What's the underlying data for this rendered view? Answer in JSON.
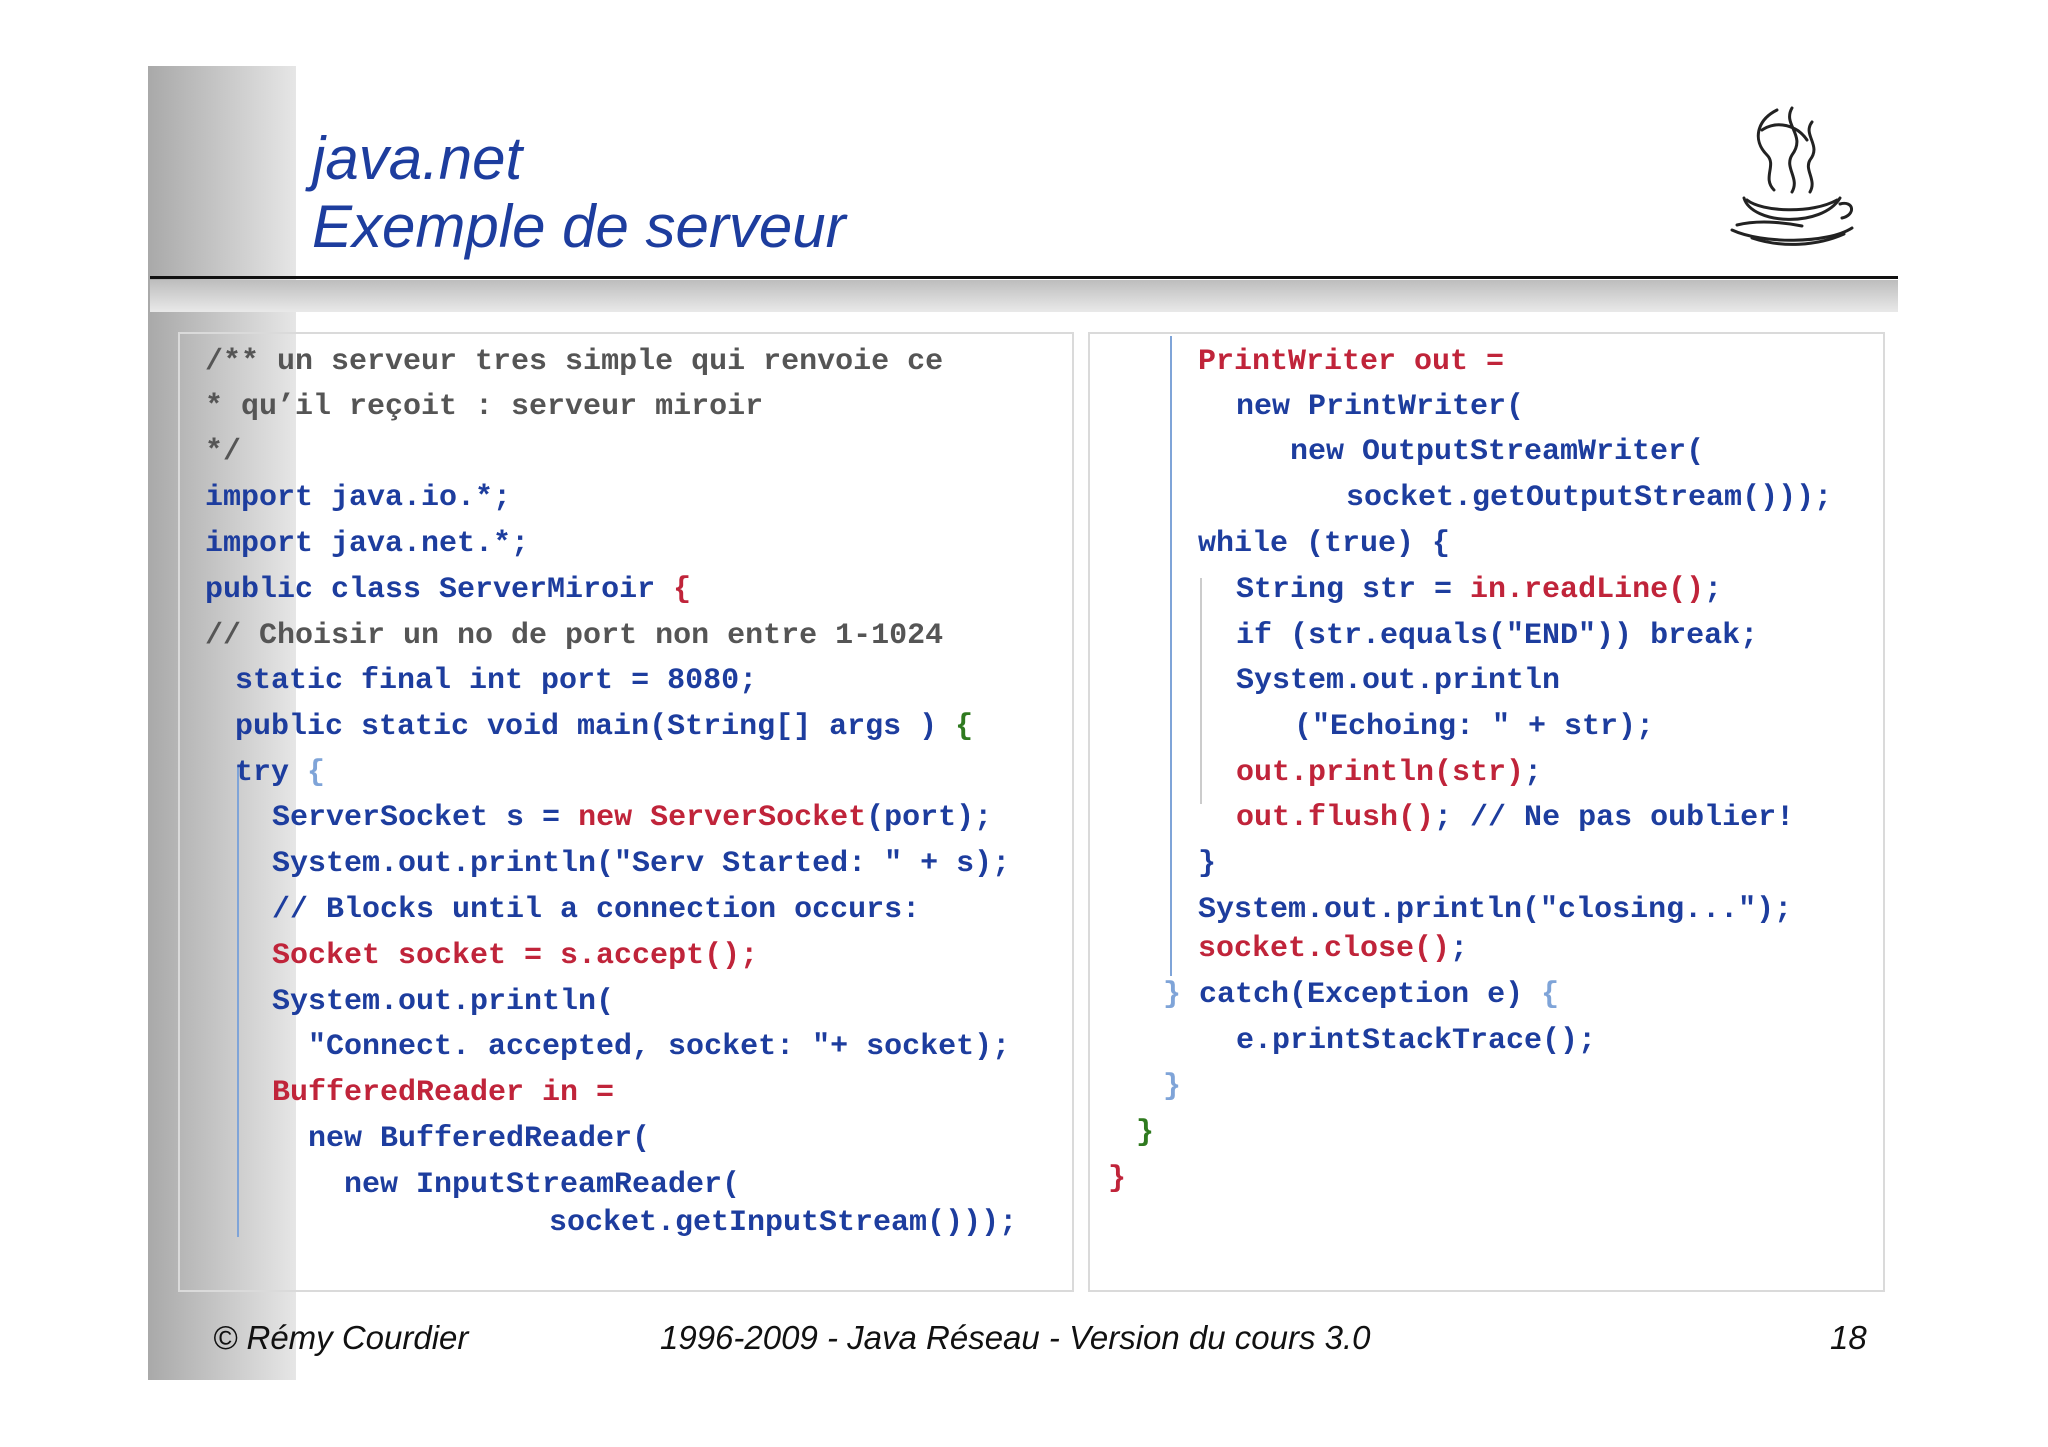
{
  "slide": {
    "title_line1": "java.net",
    "title_line2": "Exemple de serveur"
  },
  "logo": {
    "icon": "java-coffee-cup-logo"
  },
  "code_left": [
    "/** un serveur tres simple qui renvoie ce",
    "* qu’il reçoit : serveur miroir",
    "*/",
    "import java.io.*;",
    "import java.net.*;",
    "public class ServerMiroir",
    "{",
    "// Choisir un no de port non entre 1-1024",
    "static final int port = 8080;",
    "public static void main(String[] args )",
    "{",
    "try",
    "{",
    "ServerSocket s = ",
    "new ServerSocket",
    "(port);",
    "System.out.println(\"Serv Started: \" + s);",
    "// Blocks until a connection occurs:",
    "Socket socket = s.accept();",
    "System.out.println(",
    "\"Connect. accepted, socket: \"+ socket);",
    "BufferedReader in =",
    "new BufferedReader(",
    "new InputStreamReader(",
    "socket.getInputStream()));"
  ],
  "code_right": [
    "PrintWriter out =",
    "new PrintWriter(",
    "new OutputStreamWriter(",
    "socket.getOutputStream()));",
    "while (true) {",
    "String str = ",
    "in.readLine()",
    ";",
    "if (str.equals(\"END\")) break;",
    "System.out.println",
    "(\"Echoing: \" + str);",
    "out.println(str)",
    ";",
    "out.flush()",
    "; // Ne pas oublier!",
    "}",
    "System.out.println(\"closing...\");",
    "socket.close()",
    ";",
    "}",
    "catch(Exception e)",
    "{",
    "e.printStackTrace();",
    "}",
    "}",
    "}"
  ],
  "footer": {
    "author": "© Rémy Courdier",
    "course": "1996-2009 - Java Réseau - Version du cours 3.0",
    "page_number": "18"
  },
  "colors": {
    "title_blue": "#1d3d9e",
    "code_blue": "#1d3d9e",
    "code_red": "#c0243a",
    "code_green": "#2f7a1f",
    "comment_gray": "#555555"
  }
}
